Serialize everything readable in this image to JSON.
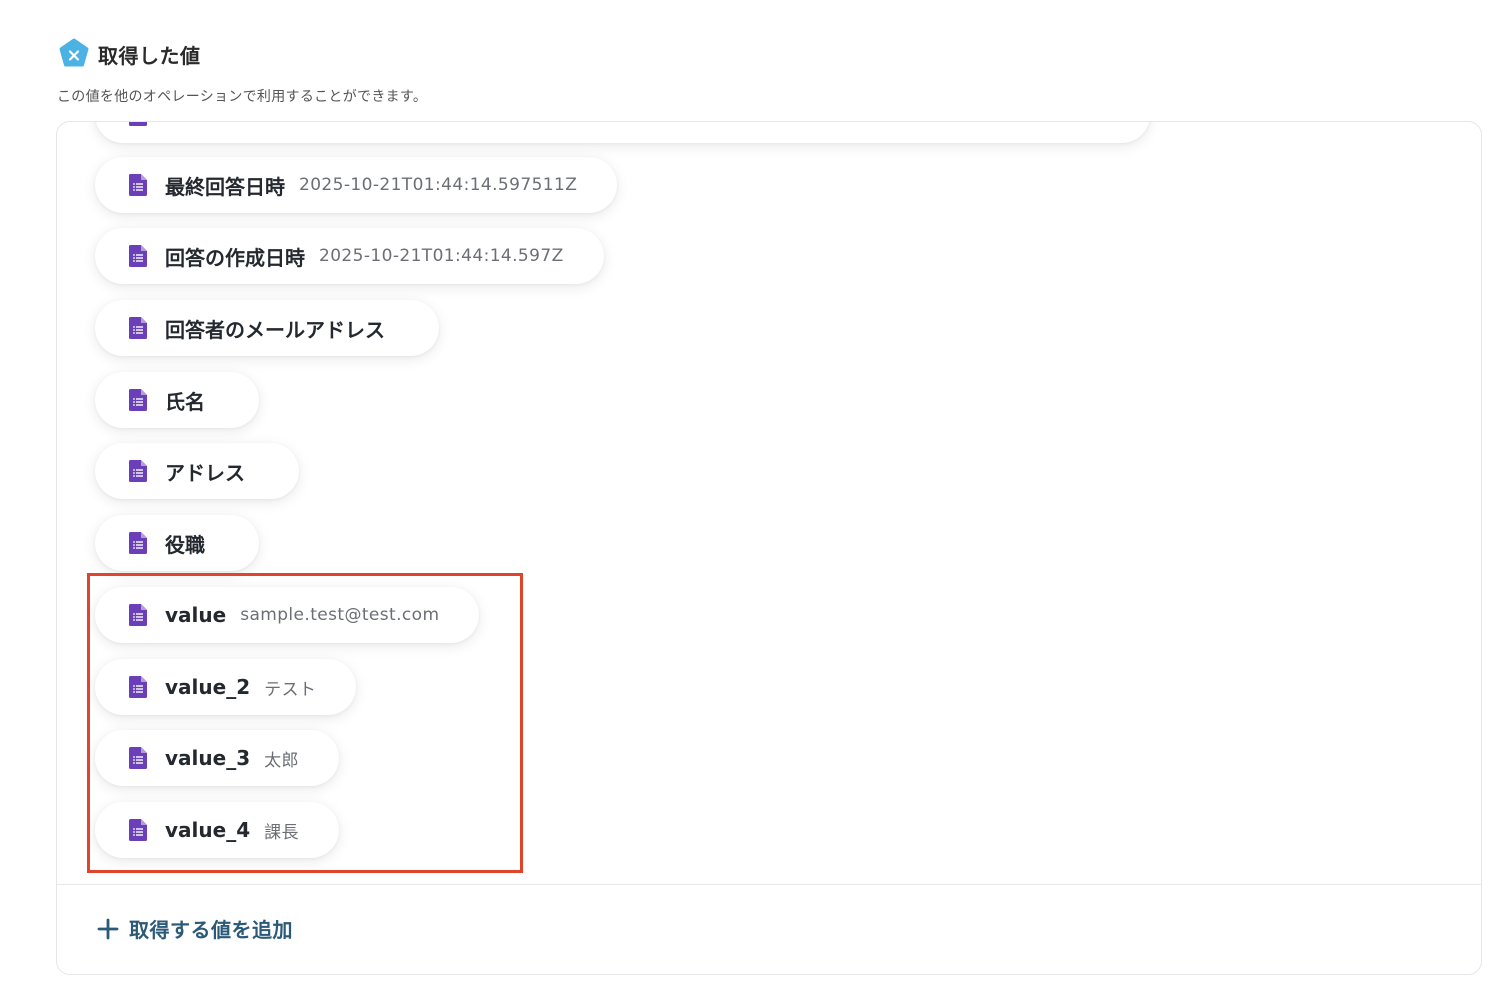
{
  "header": {
    "title": "取得した値",
    "subtitle": "この値を他のオペレーションで利用することができます。",
    "icon": "variable-x-icon",
    "icon_color": "#4cb1e3"
  },
  "fields": [
    {
      "label": "",
      "value": ""
    },
    {
      "label": "最終回答日時",
      "value": "2025-10-21T01:44:14.597511Z"
    },
    {
      "label": "回答の作成日時",
      "value": "2025-10-21T01:44:14.597Z"
    },
    {
      "label": "回答者のメールアドレス",
      "value": ""
    },
    {
      "label": "氏名",
      "value": ""
    },
    {
      "label": "アドレス",
      "value": ""
    },
    {
      "label": "役職",
      "value": ""
    },
    {
      "label": "value",
      "value": "sample.test@test.com"
    },
    {
      "label": "value_2",
      "value": "テスト"
    },
    {
      "label": "value_3",
      "value": "太郎"
    },
    {
      "label": "value_4",
      "value": "課長"
    }
  ],
  "field_icon": "google-forms-document-icon",
  "field_icon_color": "#6b3fb8",
  "add_button": {
    "label": "取得する値を追加",
    "icon": "plus-icon",
    "color": "#2b5a78"
  },
  "highlight_color": "#e0452b"
}
